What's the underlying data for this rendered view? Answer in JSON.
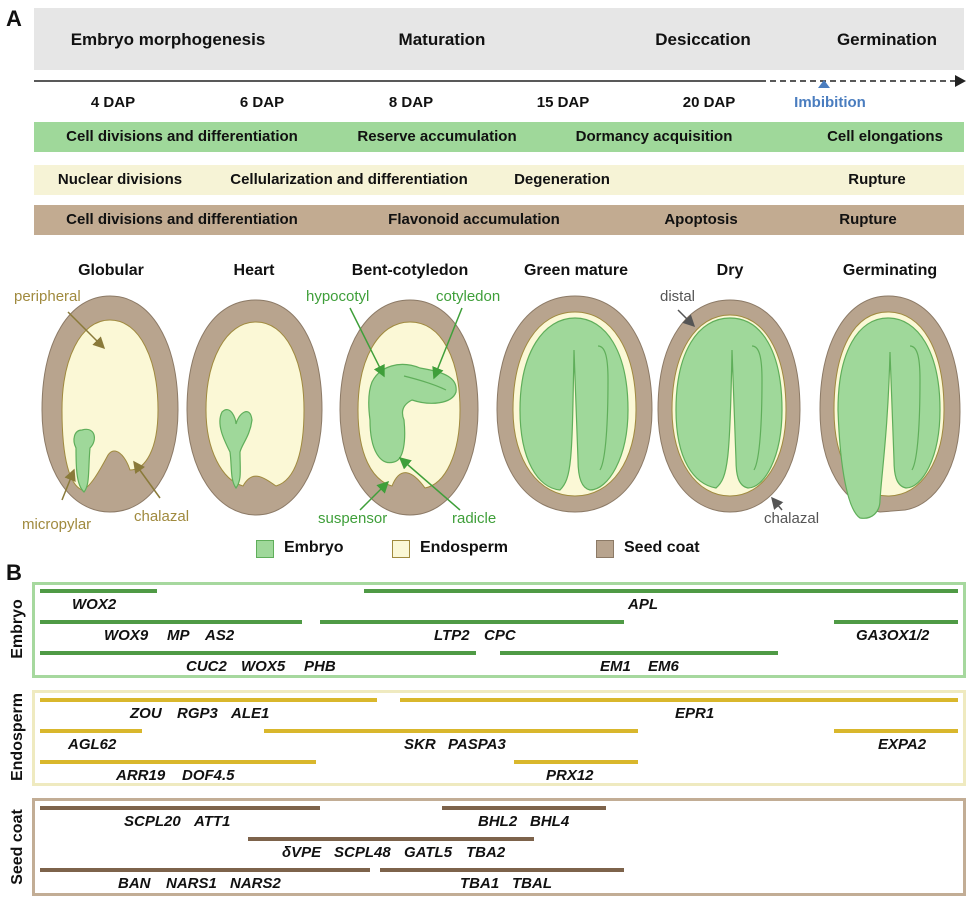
{
  "panel_a": {
    "letter": "A",
    "stages": [
      "Embryo morphogenesis",
      "Maturation",
      "Desiccation",
      "Germination"
    ],
    "dap": [
      "4 DAP",
      "6 DAP",
      "8 DAP",
      "15 DAP",
      "20 DAP"
    ],
    "imbibition": "Imbibition",
    "bands": {
      "embryo": [
        "Cell divisions and differentiation",
        "Reserve accumulation",
        "Dormancy acquisition",
        "Cell elongations"
      ],
      "endosperm": [
        "Nuclear divisions",
        "Cellularization and differentiation",
        "Degeneration",
        "Rupture"
      ],
      "seedcoat": [
        "Cell divisions and differentiation",
        "Flavonoid accumulation",
        "Apoptosis",
        "Rupture"
      ]
    },
    "seed_stages": [
      "Globular",
      "Heart",
      "Bent-cotyledon",
      "Green mature",
      "Dry",
      "Germinating"
    ],
    "annotations": {
      "peripheral": "peripheral",
      "micropylar": "micropylar",
      "chalazal": "chalazal",
      "hypocotyl": "hypocotyl",
      "cotyledon": "cotyledon",
      "suspensor": "suspensor",
      "radicle": "radicle",
      "distal": "distal",
      "chalazal2": "chalazal"
    },
    "legend": [
      "Embryo",
      "Endosperm",
      "Seed coat"
    ],
    "colors": {
      "stage_bar": "#e6e6e6",
      "embryo_band": "#9fd89a",
      "endosperm_band": "#f6f3d6",
      "seedcoat_band": "#c2ab91",
      "embryo": "#9fd89a",
      "embryo_stroke": "#5fae5a",
      "endosperm": "#fbf8d6",
      "seedcoat": "#b8a48e",
      "annotation_endo": "#a08a3e",
      "annotation_embryo": "#3f9f3a",
      "imbibition": "#4a7dbf"
    }
  },
  "panel_b": {
    "letter": "B",
    "groups": {
      "embryo": {
        "label": "Embryo",
        "genes": {
          "wox2": "WOX2",
          "apl": "APL",
          "wox9": "WOX9",
          "mp": "MP",
          "as2": "AS2",
          "ltp2": "LTP2",
          "cpc": "CPC",
          "ga3ox": "GA3OX1/2",
          "cuc2": "CUC2",
          "wox5": "WOX5",
          "phb": "PHB",
          "em1": "EM1",
          "em6": "EM6"
        }
      },
      "endosperm": {
        "label": "Endosperm",
        "genes": {
          "zou": "ZOU",
          "rgp3": "RGP3",
          "ale1": "ALE1",
          "epr1": "EPR1",
          "agl62": "AGL62",
          "skr": "SKR",
          "paspa3": "PASPA3",
          "expa2": "EXPA2",
          "arr19": "ARR19",
          "dof45": "DOF4.5",
          "prx12": "PRX12"
        }
      },
      "seedcoat": {
        "label": "Seed coat",
        "genes": {
          "scpl20": "SCPL20",
          "att1": "ATT1",
          "bhl2": "BHL2",
          "bhl4": "BHL4",
          "dvpe": "δVPE",
          "scpl48": "SCPL48",
          "gatl5": "GATL5",
          "tba2": "TBA2",
          "ban": "BAN",
          "nars1": "NARS1",
          "nars2": "NARS2",
          "tba1": "TBA1",
          "tbal": "TBAL"
        }
      }
    },
    "colors": {
      "embryo_line": "#4f9a45",
      "embryo_box": "#a6d89e",
      "endo_line": "#d9b72c",
      "endo_box": "#efeac0",
      "seed_line": "#7d634b",
      "seed_box": "#c2ad95"
    }
  }
}
